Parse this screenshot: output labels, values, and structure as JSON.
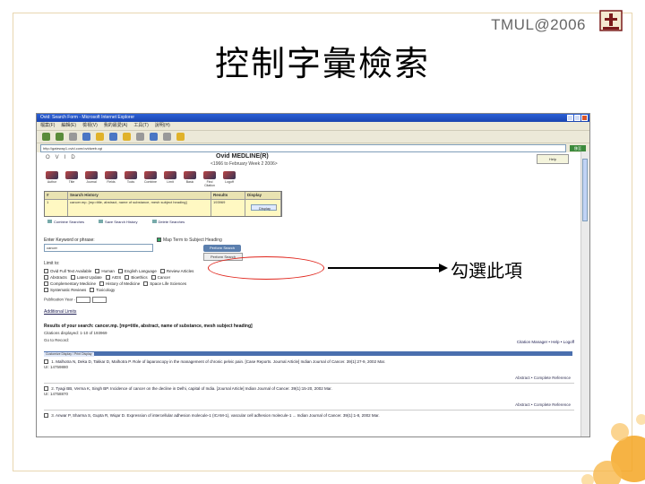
{
  "slide": {
    "title": "控制字彙檢索",
    "brand": "TMUL@2006",
    "annotation": "勾選此項",
    "colors": {
      "accent": "#e0241b",
      "circles": "#f5a623"
    }
  },
  "browser": {
    "window_title": "Ovid: Search Form - Microsoft Internet Explorer",
    "menu": [
      "檔案(F)",
      "編輯(E)",
      "檢視(V)",
      "我的最愛(A)",
      "工具(T)",
      "說明(H)"
    ],
    "address": "http://gateway1.ovid.com/ovidweb.cgi",
    "go_label": "移至"
  },
  "ovid": {
    "logo_text": "OVID",
    "db_title": "Ovid MEDLINE(R)",
    "db_subtitle": "<1966 to February Week 2 2006>",
    "help_label": "Help",
    "tools": [
      "Author",
      "Title",
      "Journal",
      "Fields",
      "Tools",
      "Combine",
      "Limit",
      "Basic",
      "Find Citation",
      "Logoff"
    ],
    "history": {
      "headers": [
        "#",
        "Search History",
        "Results",
        "Display"
      ],
      "row": {
        "num": "1",
        "query": "cancer.mp. [mp=title, abstract, name of substance, mesh subject heading]",
        "results": "193969",
        "display_label": "Display"
      },
      "links": [
        "Combine Searches",
        "Save Search History",
        "Delete Searches"
      ]
    },
    "keyword_label": "Enter Keyword or phrase:",
    "keyword_value": "cancer",
    "map_label": "Map Term to Subject Heading",
    "perform_label": "Perform Search",
    "secondary_label": "Perform Search",
    "limit_label": "Limit to:",
    "limits": [
      [
        "Ovid Full Text Available",
        "Human",
        "English Language",
        "Review Articles"
      ],
      [
        "Abstracts",
        "Latest Update",
        "AIDS",
        "Bioethics",
        "Cancer"
      ],
      [
        "Complementary Medicine",
        "History of Medicine",
        "Space Life Sciences"
      ],
      [
        "Systematic Reviews",
        "Toxicology"
      ]
    ],
    "pubyear_label": "Publication Year -",
    "add_limits": "Additional Limits",
    "results_title": "Results of your search: cancer.mp. [mp=title, abstract, name of substance, mesh subject heading]",
    "results_count": "Citations displayed: 1-10 of 193969",
    "results_count2": "Go to Record:",
    "citation_links": "Citation Manager • Help • Logoff",
    "results_bar": "Customize Display / Print Display",
    "records": [
      {
        "num": "1.",
        "text": "Malhotra N, Deka D, Takkar D, Malhotra P. Role of laparoscopy in the management of chronic pelvic pain. [Case Reports. Journal Article] Indian Journal of Cancer. 39(1):27-9, 2002 Mar.",
        "ui": "UI: 14759880",
        "links": "Abstract • Complete Reference"
      },
      {
        "num": "2.",
        "text": "Tyagi BB, Verma K, Singh BP. Incidence of cancer on the decline in Delhi, capital of India. [Journal Article] Indian Journal of Cancer. 39(1):15-20, 2002 Mar.",
        "ui": "UI: 14758870",
        "links": "Abstract • Complete Reference"
      },
      {
        "num": "3.",
        "text": "Anwar P, Sharma S, Gupta R, Wiqar D. Expression of intercellular adhesion molecule-1 (ICAM-1), vascular cell adhesion molecule-1 ... Indian Journal of Cancer. 39(1):1-8, 2002 Mar.",
        "ui": "",
        "links": ""
      }
    ],
    "citation_btn": "Citation Manager"
  }
}
